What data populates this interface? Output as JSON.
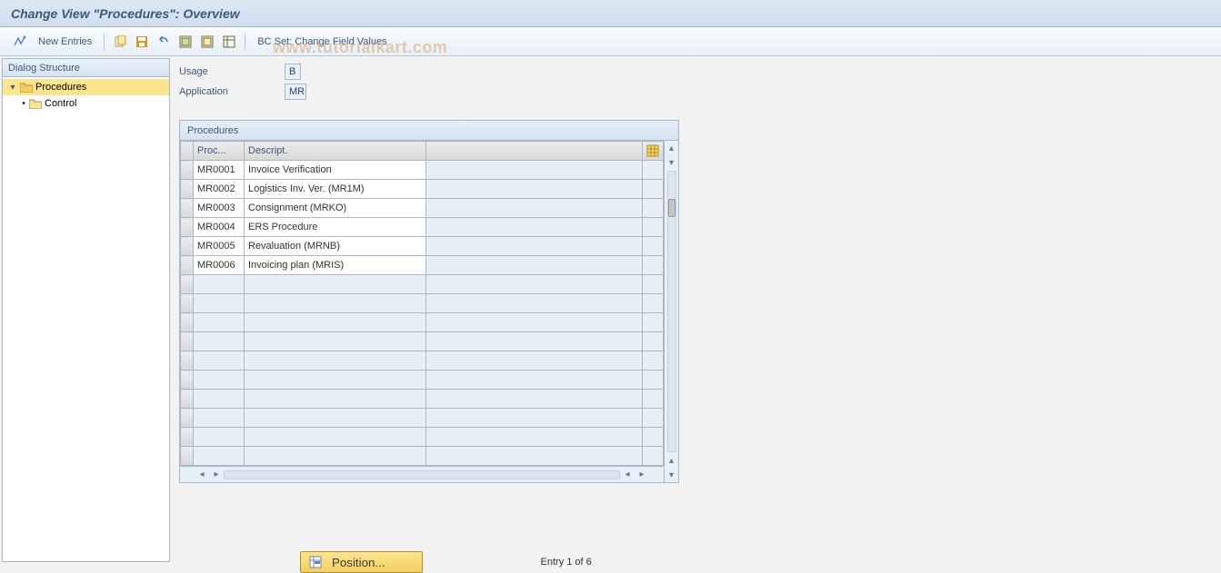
{
  "title": "Change View \"Procedures\": Overview",
  "watermark": "www.tutorialkart.com",
  "toolbar": {
    "new_entries_label": "New Entries",
    "bc_set_label": "BC Set: Change Field Values"
  },
  "tree": {
    "header": "Dialog Structure",
    "items": [
      {
        "label": "Procedures",
        "expanded": true,
        "selected": true
      },
      {
        "label": "Control",
        "expanded": false,
        "selected": false
      }
    ]
  },
  "fields": {
    "usage": {
      "label": "Usage",
      "value": "B"
    },
    "application": {
      "label": "Application",
      "value": "MR"
    }
  },
  "table": {
    "group_title": "Procedures",
    "columns": {
      "proc": "Proc...",
      "desc": "Descript."
    },
    "rows": [
      {
        "proc": "MR0001",
        "desc": "Invoice Verification",
        "selected": true
      },
      {
        "proc": "MR0002",
        "desc": "Logistics Inv. Ver. (MR1M)",
        "selected": false
      },
      {
        "proc": "MR0003",
        "desc": "Consignment (MRKO)",
        "selected": false
      },
      {
        "proc": "MR0004",
        "desc": "ERS Procedure",
        "selected": false
      },
      {
        "proc": "MR0005",
        "desc": "Revaluation (MRNB)",
        "selected": false
      },
      {
        "proc": "MR0006",
        "desc": "Invoicing plan (MRIS)",
        "selected": false
      }
    ],
    "empty_row_count": 10
  },
  "footer": {
    "position_label": "Position...",
    "entry_status": "Entry 1 of 6"
  }
}
